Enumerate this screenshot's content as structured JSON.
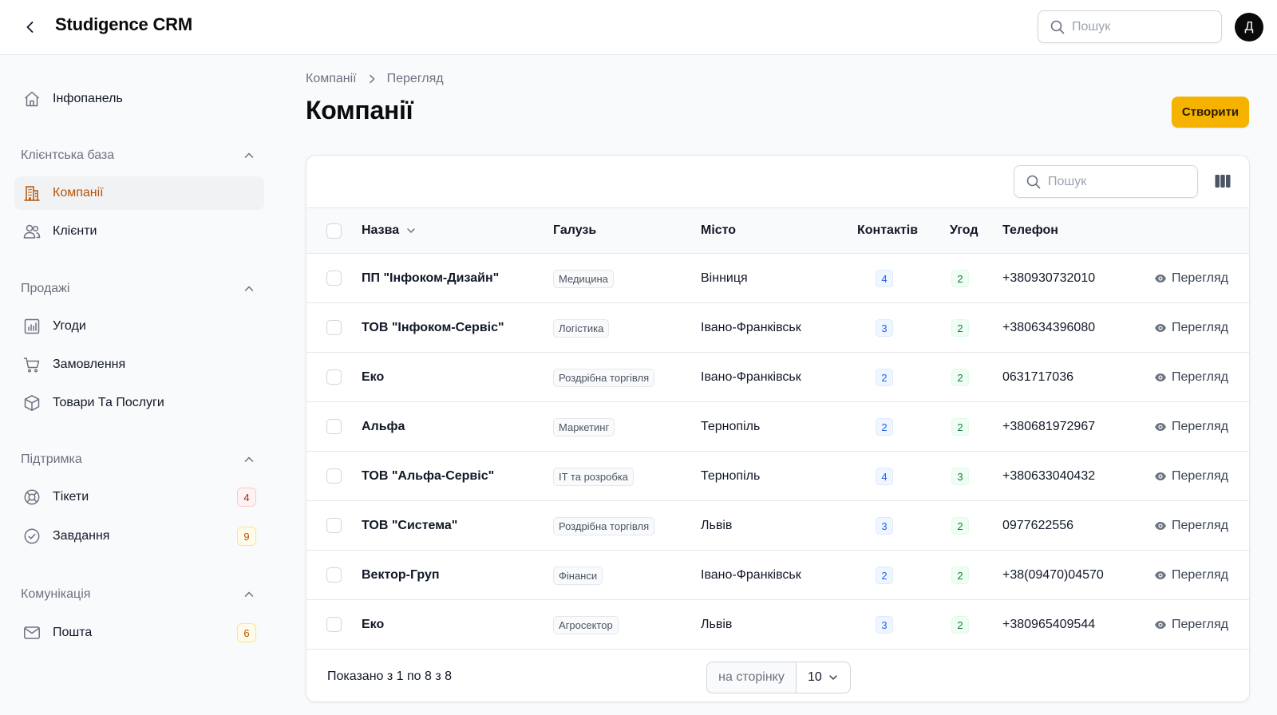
{
  "app": {
    "title": "Studigence CRM",
    "avatar_letter": "Д"
  },
  "topbar": {
    "search_placeholder": "Пошук"
  },
  "sidebar": {
    "dashboard": "Інфопанель",
    "groups": {
      "clients": {
        "title": "Клієнтська база",
        "items": [
          "Компанії",
          "Клієнти"
        ]
      },
      "sales": {
        "title": "Продажі",
        "items": [
          "Угоди",
          "Замовлення",
          "Товари Та Послуги"
        ]
      },
      "support": {
        "title": "Підтримка",
        "items": [
          "Тікети",
          "Завдання"
        ],
        "badges": [
          "4",
          "9"
        ]
      },
      "comms": {
        "title": "Комунікація",
        "items": [
          "Пошта"
        ],
        "badges": [
          "6"
        ]
      }
    },
    "active_item": "Компанії"
  },
  "breadcrumb": {
    "parent": "Компанії",
    "current": "Перегляд"
  },
  "page": {
    "title": "Компанії",
    "create_label": "Створити"
  },
  "table": {
    "search_placeholder": "Пошук",
    "columns": {
      "name": "Назва",
      "industry": "Галузь",
      "city": "Місто",
      "contacts": "Контактів",
      "deals": "Угод",
      "phone": "Телефон"
    },
    "view_label": "Перегляд",
    "rows": [
      {
        "name": "ПП \"Інфоком-Дизайн\"",
        "industry": "Медицина",
        "city": "Вінниця",
        "contacts": "4",
        "deals": "2",
        "phone": "+380930732010"
      },
      {
        "name": "ТОВ \"Інфоком-Сервіс\"",
        "industry": "Логістика",
        "city": "Івано-Франківськ",
        "contacts": "3",
        "deals": "2",
        "phone": "+380634396080"
      },
      {
        "name": "Еко",
        "industry": "Роздрібна торгівля",
        "city": "Івано-Франківськ",
        "contacts": "2",
        "deals": "2",
        "phone": "0631717036"
      },
      {
        "name": "Альфа",
        "industry": "Маркетинг",
        "city": "Тернопіль",
        "contacts": "2",
        "deals": "2",
        "phone": "+380681972967"
      },
      {
        "name": "ТОВ \"Альфа-Сервіс\"",
        "industry": "IT та розробка",
        "city": "Тернопіль",
        "contacts": "4",
        "deals": "3",
        "phone": "+380633040432"
      },
      {
        "name": "ТОВ \"Система\"",
        "industry": "Роздрібна торгівля",
        "city": "Львів",
        "contacts": "3",
        "deals": "2",
        "phone": "0977622556"
      },
      {
        "name": "Вектор-Груп",
        "industry": "Фінанси",
        "city": "Івано-Франківськ",
        "contacts": "2",
        "deals": "2",
        "phone": "+38(09470)04570"
      },
      {
        "name": "Еко",
        "industry": "Агросектор",
        "city": "Львів",
        "contacts": "3",
        "deals": "2",
        "phone": "+380965409544"
      }
    ],
    "footer": {
      "showing": "Показано з 1 по 8 з 8",
      "per_page_label": "на сторінку",
      "per_page_value": "10"
    }
  },
  "colors": {
    "accent": "#f5b300",
    "active_nav_text": "#b45309",
    "contacts_badge": "#2563eb",
    "deals_badge": "#15803d"
  }
}
